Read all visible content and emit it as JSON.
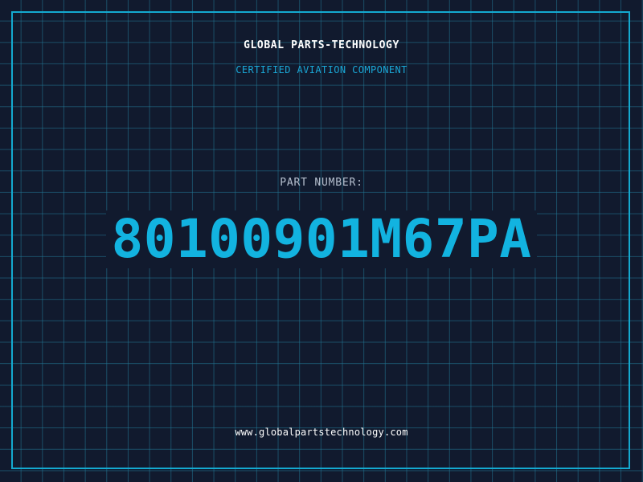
{
  "header": {
    "company": "GLOBAL PARTS-TECHNOLOGY",
    "subtitle": "CERTIFIED AVIATION COMPONENT"
  },
  "part": {
    "label": "PART NUMBER:",
    "number": "80100901M67PA"
  },
  "footer": {
    "website": "www.globalpartstechnology.com"
  },
  "colors": {
    "background": "#111a2e",
    "grid": "#22789a",
    "accent": "#14a9d0",
    "text": "#ffffff",
    "muted": "#b6c0cf"
  }
}
